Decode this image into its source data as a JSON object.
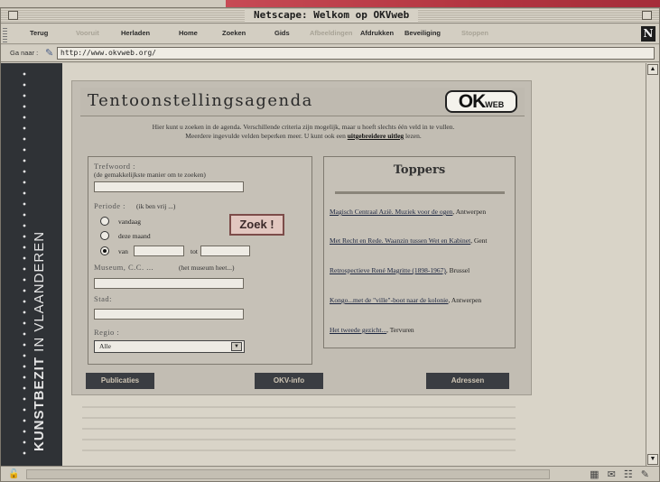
{
  "window": {
    "title": "Netscape: Welkom op OKVweb"
  },
  "toolbar": {
    "buttons": [
      {
        "label": "Terug",
        "enabled": true
      },
      {
        "label": "Vooruit",
        "enabled": false
      },
      {
        "label": "Herladen",
        "enabled": true
      },
      {
        "label": "Home",
        "enabled": true
      },
      {
        "label": "Zoeken",
        "enabled": true
      },
      {
        "label": "Gids",
        "enabled": true
      },
      {
        "label": "Afbeeldingen",
        "enabled": false
      },
      {
        "label": "Afdrukken",
        "enabled": true
      },
      {
        "label": "Beveiliging",
        "enabled": true
      },
      {
        "label": "Stoppen",
        "enabled": false
      }
    ],
    "logo": "N"
  },
  "location": {
    "label": "Ga naar :",
    "url": "http://www.okvweb.org/"
  },
  "sidebar": {
    "text_bold": "KUNSTBEZIT",
    "text_rest": " IN VLAANDEREN"
  },
  "page": {
    "title": "Tentoonstellingsagenda",
    "logo_big": "OK",
    "logo_small": "WEB",
    "intro_line1": "Hier kunt u zoeken in de agenda. Verschillende criteria zijn mogelijk, maar u hoeft slechts één veld in te vullen.",
    "intro_line2_a": "Meerdere ingevulde velden beperken meer. U kunt ook een ",
    "intro_link": "uitgebreidere uitleg",
    "intro_line2_b": " lezen."
  },
  "form": {
    "trefwoord_label": "Trefwoord :",
    "trefwoord_note": "(de gemakkelijkste manier om te zoeken)",
    "periode_label": "Periode :",
    "periode_note": "(ik ben vrij ...)",
    "radio_vandaag": "vandaag",
    "radio_maand": "deze maand",
    "radio_van": "van",
    "tot_label": "tot",
    "museum_label": "Museum, C.C. ...",
    "museum_note": "(het museum heet...)",
    "stad_label": "Stad:",
    "regio_label": "Regio :",
    "regio_value": "Alle",
    "zoek_button": "Zoek !"
  },
  "toppers": {
    "title": "Toppers",
    "items": [
      {
        "title": "Magisch Centraal Azië. Muziek voor de ogen",
        "place": ", Antwerpen"
      },
      {
        "title": "Met Recht en Rede. Waanzin tussen Wet en Kabinet",
        "place": ", Gent"
      },
      {
        "title": "Retrospectieve René Magritte (1898-1967)",
        "place": ", Brussel"
      },
      {
        "title": "Kongo...met de \"ville\"-boot naar de kolonie",
        "place": ", Antwerpen"
      },
      {
        "title": "Het tweede gezicht...",
        "place": ", Tervuren"
      }
    ]
  },
  "nav": {
    "publicaties": "Publicaties",
    "okvinfo": "OKV-info",
    "adressen": "Adressen"
  },
  "colors": {
    "sidebar": "#2f3236",
    "button": "#3a3d42",
    "zoek": "#e2c7c0"
  }
}
